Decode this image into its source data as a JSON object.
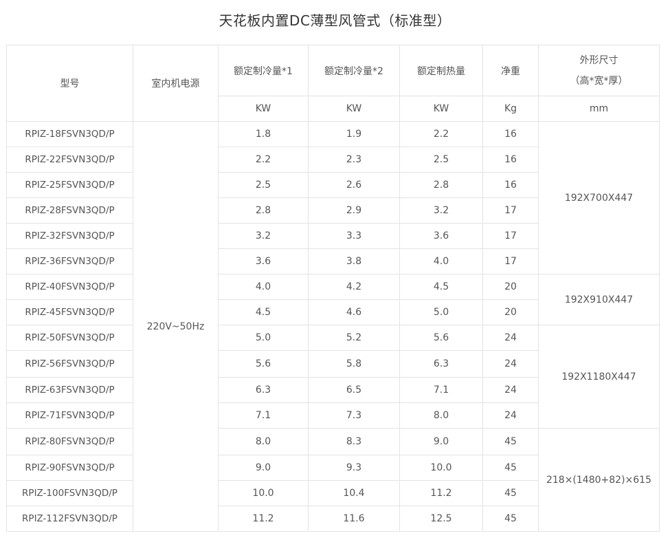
{
  "title": "天花板内置DC薄型风管式（标准型）",
  "headers": {
    "model": "型号",
    "power_source": "室内机电源",
    "cooling1": "额定制冷量*1",
    "cooling2": "额定制冷量*2",
    "heating": "额定制热量",
    "net_weight": "净重",
    "dimensions_line1": "外形尺寸",
    "dimensions_line2": "（高*宽*厚）"
  },
  "units": {
    "cooling1": "KW",
    "cooling2": "KW",
    "heating": "KW",
    "net_weight": "Kg",
    "dimensions": "mm"
  },
  "power_source_value": "220V~50Hz",
  "rows": [
    {
      "model": "RPIZ-18FSVN3QD/P",
      "cooling1": "1.8",
      "cooling2": "1.9",
      "heating": "2.2",
      "weight": "16"
    },
    {
      "model": "RPIZ-22FSVN3QD/P",
      "cooling1": "2.2",
      "cooling2": "2.3",
      "heating": "2.5",
      "weight": "16"
    },
    {
      "model": "RPIZ-25FSVN3QD/P",
      "cooling1": "2.5",
      "cooling2": "2.6",
      "heating": "2.8",
      "weight": "16"
    },
    {
      "model": "RPIZ-28FSVN3QD/P",
      "cooling1": "2.8",
      "cooling2": "2.9",
      "heating": "3.2",
      "weight": "17"
    },
    {
      "model": "RPIZ-32FSVN3QD/P",
      "cooling1": "3.2",
      "cooling2": "3.3",
      "heating": "3.6",
      "weight": "17"
    },
    {
      "model": "RPIZ-36FSVN3QD/P",
      "cooling1": "3.6",
      "cooling2": "3.8",
      "heating": "4.0",
      "weight": "17"
    },
    {
      "model": "RPIZ-40FSVN3QD/P",
      "cooling1": "4.0",
      "cooling2": "4.2",
      "heating": "4.5",
      "weight": "20"
    },
    {
      "model": "RPIZ-45FSVN3QD/P",
      "cooling1": "4.5",
      "cooling2": "4.6",
      "heating": "5.0",
      "weight": "20"
    },
    {
      "model": "RPIZ-50FSVN3QD/P",
      "cooling1": "5.0",
      "cooling2": "5.2",
      "heating": "5.6",
      "weight": "24"
    },
    {
      "model": "RPIZ-56FSVN3QD/P",
      "cooling1": "5.6",
      "cooling2": "5.8",
      "heating": "6.3",
      "weight": "24"
    },
    {
      "model": "RPIZ-63FSVN3QD/P",
      "cooling1": "6.3",
      "cooling2": "6.5",
      "heating": "7.1",
      "weight": "24"
    },
    {
      "model": "RPIZ-71FSVN3QD/P",
      "cooling1": "7.1",
      "cooling2": "7.3",
      "heating": "8.0",
      "weight": "24"
    },
    {
      "model": "RPIZ-80FSVN3QD/P",
      "cooling1": "8.0",
      "cooling2": "8.3",
      "heating": "9.0",
      "weight": "45"
    },
    {
      "model": "RPIZ-90FSVN3QD/P",
      "cooling1": "9.0",
      "cooling2": "9.3",
      "heating": "10.0",
      "weight": "45"
    },
    {
      "model": "RPIZ-100FSVN3QD/P",
      "cooling1": "10.0",
      "cooling2": "10.4",
      "heating": "11.2",
      "weight": "45"
    },
    {
      "model": "RPIZ-112FSVN3QD/P",
      "cooling1": "11.2",
      "cooling2": "11.6",
      "heating": "12.5",
      "weight": "45"
    }
  ],
  "dimension_groups": [
    {
      "value": "192X700X447",
      "rows": 6
    },
    {
      "value": "192X910X447",
      "rows": 2
    },
    {
      "value": "192X1180X447",
      "rows": 4
    },
    {
      "value": "218×(1480+82)×615",
      "rows": 4
    }
  ]
}
